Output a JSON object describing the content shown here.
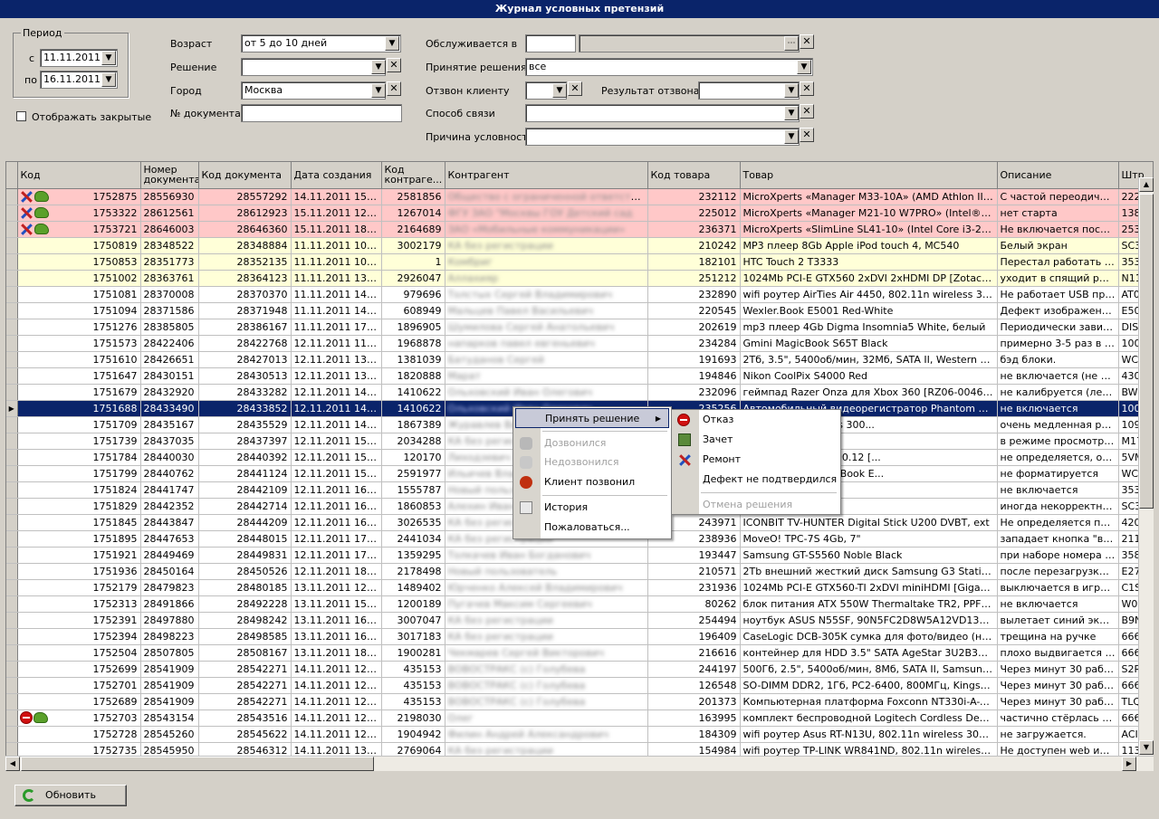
{
  "title": "Журнал условных претензий",
  "period": {
    "legend": "Период",
    "from_label": "с",
    "from": "11.11.2011",
    "to_label": "по",
    "to": "16.11.2011"
  },
  "show_closed": "Отображать закрытые",
  "filters": {
    "age_label": "Возраст",
    "age": "от 5 до 10 дней",
    "decision_label": "Решение",
    "decision": "",
    "city_label": "Город",
    "city": "Москва",
    "doc_label": "№ документа",
    "doc": "",
    "served_label": "Обслуживается в",
    "served": "",
    "accept_label": "Принятие решения",
    "accept": "все",
    "callback_label": "Отзвон клиенту",
    "callback": "",
    "callres_label": "Результат отзвона",
    "callres": "",
    "contact_label": "Способ связи",
    "contact": "",
    "reason_label": "Причина условности",
    "reason": ""
  },
  "columns": [
    "Код",
    "Номер документа",
    "Код документа",
    "Дата создания",
    "Код контраге...",
    "Контрагент",
    "Код товара",
    "Товар",
    "Описание",
    "Штр"
  ],
  "rows": [
    {
      "s": "pink",
      "i": "tc",
      "code": "1752875",
      "num": "28556930",
      "doc": "28557292",
      "date": "14.11.2011 15:14",
      "cc": "2581856",
      "cp": "Общество с ограниченной ответственностью",
      "gc": "232112",
      "goods": "MicroXperts «Manager M33-10A» (AMD Athlon II X4 64...",
      "desc": "С частой переодичнос...",
      "bc": "2225"
    },
    {
      "s": "pink",
      "i": "tc",
      "code": "1753322",
      "num": "28612561",
      "doc": "28612923",
      "date": "15.11.2011 12:01",
      "cc": "1267014",
      "cp": "ФГУ ЗАО \"Москвы ГОУ Детский сад",
      "gc": "225012",
      "goods": "MicroXperts «Manager M21-10 W7PRO» (Intel® Core...",
      "desc": "нет старта",
      "bc": "1383"
    },
    {
      "s": "pink",
      "i": "tc",
      "code": "1753721",
      "num": "28646003",
      "doc": "28646360",
      "date": "15.11.2011 18:27",
      "cc": "2164689",
      "cp": "ЗАО «Мобильные коммуникации»",
      "gc": "236371",
      "goods": "MicroXperts «SlimLine SL41-10» (Intel Core i3-2100, RA...",
      "desc": "Не включается после ...",
      "bc": "2539"
    },
    {
      "s": "yellow",
      "i": "",
      "code": "1750819",
      "num": "28348522",
      "doc": "28348884",
      "date": "11.11.2011 10:05",
      "cc": "3002179",
      "cp": "КА без регистрации",
      "gc": "210242",
      "goods": "MP3 плеер 8Gb Apple iPod touch 4, MC540",
      "desc": "Белый экран",
      "bc": "SC3\\"
    },
    {
      "s": "yellow",
      "i": "",
      "code": "1750853",
      "num": "28351773",
      "doc": "28352135",
      "date": "11.11.2011 10:52",
      "cc": "1",
      "cp": "Комбриг",
      "gc": "182101",
      "goods": "HTC Touch 2  T3333",
      "desc": "Перестал работать та...",
      "bc": "3539"
    },
    {
      "s": "yellow",
      "i": "",
      "code": "1751002",
      "num": "28363761",
      "doc": "28364123",
      "date": "11.11.2011 13:15",
      "cc": "2926047",
      "cp": "Аллахияр",
      "gc": "251212",
      "goods": "1024Mb PCI-E GTX560 2xDVI 2xHDMI DP [Zotac ZT-50...",
      "desc": " уходит в спящий реж...",
      "bc": "N113"
    },
    {
      "s": "",
      "i": "",
      "code": "1751081",
      "num": "28370008",
      "doc": "28370370",
      "date": "11.11.2011 14:29",
      "cc": "979696",
      "cp": "Толстых Сергей Владимирович",
      "gc": "232890",
      "goods": "wifi роутер AirTies Air 4450, 802.11n wireless 300Mbp...",
      "desc": "Не работает USB прин...",
      "bc": "AT06"
    },
    {
      "s": "",
      "i": "",
      "code": "1751094",
      "num": "28371586",
      "doc": "28371948",
      "date": "11.11.2011 14:48",
      "cc": "608949",
      "cp": "Мальцев Павел Васильевич",
      "gc": "220545",
      "goods": "Wexler.Book E5001 Red-White",
      "desc": "Дефект изображение,...",
      "bc": "E500"
    },
    {
      "s": "",
      "i": "",
      "code": "1751276",
      "num": "28385805",
      "doc": "28386167",
      "date": "11.11.2011 17:26",
      "cc": "1896905",
      "cp": "Шумилова Сергей Анатольевич",
      "gc": "202619",
      "goods": "mp3 плеер 4Gb Digma Insomnia5 White, белый",
      "desc": "Периодически зависае...",
      "bc": "DIS5"
    },
    {
      "s": "",
      "i": "",
      "code": "1751573",
      "num": "28422406",
      "doc": "28422768",
      "date": "12.11.2011 11:55",
      "cc": "1968878",
      "cp": "напарков павел евгеньевич",
      "gc": "234284",
      "goods": "Gmini MagicBook S65T Black",
      "desc": "примерно 3-5 раз в де...",
      "bc": "1000"
    },
    {
      "s": "",
      "i": "",
      "code": "1751610",
      "num": "28426651",
      "doc": "28427013",
      "date": "12.11.2011 13:01",
      "cc": "1381039",
      "cp": "Батуданов Сергей",
      "gc": "191693",
      "goods": "2Тб, 3.5\", 5400об/мин, 32Мб, SATA II, Western Digita...",
      "desc": "бэд блоки.",
      "bc": "WCA"
    },
    {
      "s": "",
      "i": "",
      "code": "1751647",
      "num": "28430151",
      "doc": "28430513",
      "date": "12.11.2011 13:47",
      "cc": "1820888",
      "cp": "Марат",
      "gc": "194846",
      "goods": "Nikon CoolPix S4000 Red",
      "desc": "не включается (не зар...",
      "bc": "4304"
    },
    {
      "s": "",
      "i": "",
      "code": "1751679",
      "num": "28432920",
      "doc": "28433282",
      "date": "12.11.2011 14:21",
      "cc": "1410622",
      "cp": "Ольховский Иван Олегович",
      "gc": "232096",
      "goods": "геймпад Razer Onza для Xbox 360 [RZ06-00460100-R...",
      "desc": "не калибруется (левы...",
      "bc": "BW1"
    },
    {
      "s": "sel",
      "i": "",
      "code": "1751688",
      "num": "28433490",
      "doc": "28433852",
      "date": "12.11.2011 14:29",
      "cc": "1410622",
      "cp": "Ольховский Иван Олегович",
      "gc": "235256",
      "goods": "Автомобильный видеорегистратор Phantom VR-107",
      "desc": "не включается",
      "bc": "1000"
    },
    {
      "s": "",
      "i": "",
      "code": "1751709",
      "num": "28435167",
      "doc": "28435529",
      "date": "12.11.2011 14:49",
      "cc": "1867389",
      "cp": "Журавлев Вадим",
      "gc": "",
      "goods": "D, 802.11n Wireless 300...",
      "desc": "очень медленная разд...",
      "bc": "1096"
    },
    {
      "s": "",
      "i": "",
      "code": "1751739",
      "num": "28437035",
      "doc": "28437397",
      "date": "12.11.2011 15:12",
      "cc": "2034288",
      "cp": "КА без регистрации",
      "gc": "",
      "goods": "300/W, 4.3\" TFT",
      "desc": "в режиме просмотра в...",
      "bc": "M17"
    },
    {
      "s": "",
      "i": "",
      "code": "1751784",
      "num": "28440030",
      "doc": "28440392",
      "date": "12.11.2011 15:49",
      "cc": "120170",
      "cp": "Лиходзевич Виталий",
      "gc": "",
      "goods": "gate Barracuda 7200.12 [...",
      "desc": "не определяется, оши...",
      "bc": "5VM"
    },
    {
      "s": "",
      "i": "",
      "code": "1751799",
      "num": "28440762",
      "doc": "28441124",
      "date": "12.11.2011 15:58",
      "cc": "2591977",
      "cp": "Ильичев Владимир",
      "gc": "",
      "goods": "Western Digital My Book E...",
      "desc": "не форматируется",
      "bc": "WCA"
    },
    {
      "s": "",
      "i": "",
      "code": "1751824",
      "num": "28441747",
      "doc": "28442109",
      "date": "12.11.2011 16:10",
      "cc": "1555787",
      "cp": "Новый пользователь",
      "gc": "",
      "goods": "104",
      "desc": "не включается",
      "bc": "3537"
    },
    {
      "s": "",
      "i": "",
      "code": "1751829",
      "num": "28442352",
      "doc": "28442714",
      "date": "12.11.2011 16:19",
      "cc": "1860853",
      "cp": "Алехин Иван",
      "gc": "",
      "goods": "ouch 4, MC544",
      "desc": "иногда некорректная ...",
      "bc": "SC3L"
    },
    {
      "s": "",
      "i": "",
      "code": "1751845",
      "num": "28443847",
      "doc": "28444209",
      "date": "12.11.2011 16:39",
      "cc": "3026535",
      "cp": "КА без регистрации",
      "gc": "243971",
      "goods": "ICONBIT TV-HUNTER Digital Stick U200 DVBT, ext",
      "desc": "Не определяется прог...",
      "bc": "4201"
    },
    {
      "s": "",
      "i": "",
      "code": "1751895",
      "num": "28447653",
      "doc": "28448015",
      "date": "12.11.2011 17:30",
      "cc": "2441034",
      "cp": "КА без регистрации",
      "gc": "238936",
      "goods": "MoveO! TPC-7S 4Gb, 7\"",
      "desc": "западает кнопка \"возв...",
      "bc": "2111"
    },
    {
      "s": "",
      "i": "",
      "code": "1751921",
      "num": "28449469",
      "doc": "28449831",
      "date": "12.11.2011 17:53",
      "cc": "1359295",
      "cp": "Толкачев Иван Богданович",
      "gc": "193447",
      "goods": "Samsung GT-S5560 Noble Black",
      "desc": "при наборе номера не ...",
      "bc": "3586"
    },
    {
      "s": "",
      "i": "",
      "code": "1751936",
      "num": "28450164",
      "doc": "28450526",
      "date": "12.11.2011 18:03",
      "cc": "2178498",
      "cp": "Новый пользователь",
      "gc": "210571",
      "goods": "2Tb внешний жесткий диск Samsung G3 Station 3.5\",...",
      "desc": "после перезагрузки оп...",
      "bc": "E272"
    },
    {
      "s": "",
      "i": "",
      "code": "1752179",
      "num": "28479823",
      "doc": "28480185",
      "date": "13.11.2011 12:10",
      "cc": "1489402",
      "cp": "Юрченко Алексей Владимирович",
      "gc": "231936",
      "goods": "1024Mb PCI-E GTX560-TI 2xDVI miniHDMI [Gigabyte G...",
      "desc": "выключается в играх(...",
      "bc": "C1SM"
    },
    {
      "s": "",
      "i": "",
      "code": "1752313",
      "num": "28491866",
      "doc": "28492228",
      "date": "13.11.2011 15:06",
      "cc": "1200189",
      "cp": "Пугачев Максим Сергеевич",
      "gc": "80262",
      "goods": "блок питания ATX 550W Thermaltake TR2, PPFC, вен...",
      "desc": "не включается",
      "bc": "W01"
    },
    {
      "s": "",
      "i": "",
      "code": "1752391",
      "num": "28497880",
      "doc": "28498242",
      "date": "13.11.2011 16:22",
      "cc": "3007047",
      "cp": "КА без регистрации",
      "gc": "254494",
      "goods": "ноутбук ASUS N55SF, 90N5FC2D8W5A12VD13AU, 15....",
      "desc": "вылетает синий экран ...",
      "bc": "B9N0"
    },
    {
      "s": "",
      "i": "",
      "code": "1752394",
      "num": "28498223",
      "doc": "28498585",
      "date": "13.11.2011 16:27",
      "cc": "3017183",
      "cp": "КА без регистрации",
      "gc": "196409",
      "goods": "CaseLogic DCB-305K сумка для фото/видео (нейлон,...",
      "desc": "трещина на ручке",
      "bc": "6660"
    },
    {
      "s": "",
      "i": "",
      "code": "1752504",
      "num": "28507805",
      "doc": "28508167",
      "date": "13.11.2011 18:54",
      "cc": "1900281",
      "cp": "Чекмарев Сергей Викторович",
      "gc": "216616",
      "goods": "контейнер для HDD 3.5\" SATA AgeStar 3U2B3A RAID...",
      "desc": "плохо выдвигается од...",
      "bc": "6660"
    },
    {
      "s": "",
      "i": "",
      "code": "1752699",
      "num": "28541909",
      "doc": "28542271",
      "date": "14.11.2011 12:20",
      "cc": "435153",
      "cp": "ВОВОСТРАКС  (с)  Голубева",
      "gc": "244197",
      "goods": "500Гб, 2.5\", 5400об/мин, 8Мб, SATA II, Samsung Spin...",
      "desc": "Через минут 30 работ...",
      "bc": "S2R7"
    },
    {
      "s": "",
      "i": "",
      "code": "1752701",
      "num": "28541909",
      "doc": "28542271",
      "date": "14.11.2011 12:20",
      "cc": "435153",
      "cp": "ВОВОСТРАКС  (с)  Голубева",
      "gc": "126548",
      "goods": "SO-DIMM DDR2, 1Гб, PC2-6400, 800МГц, Kingston, KV...",
      "desc": "Через минут 30 работ...",
      "bc": "6660"
    },
    {
      "s": "",
      "i": "",
      "code": "1752689",
      "num": "28541909",
      "doc": "28542271",
      "date": "14.11.2011 12:20",
      "cc": "435153",
      "cp": "ВОВОСТРАКС  (с)  Голубева",
      "gc": "201373",
      "goods": "Компьютерная платформа Foxconn NT330i-A-W-AE-...",
      "desc": "Через минут 30 работ...",
      "bc": "TLQE"
    },
    {
      "s": "",
      "i": "sc",
      "code": "1752703",
      "num": "28543154",
      "doc": "28543516",
      "date": "14.11.2011 12:33",
      "cc": "2198030",
      "cp": "Олег",
      "gc": "163995",
      "goods": "комплект беспроводной Logitech Cordless Desktop S...",
      "desc": "частично стёрлась ма...",
      "bc": "6660"
    },
    {
      "s": "",
      "i": "",
      "code": "1752728",
      "num": "28545260",
      "doc": "28545622",
      "date": "14.11.2011 12:52",
      "cc": "1904942",
      "cp": "Филин Андрей Александрович",
      "gc": "184309",
      "goods": "wifi роутер Asus RT-N13U, 802.11n wireless 300Mbps ...",
      "desc": "не загружается.",
      "bc": "ACIE"
    },
    {
      "s": "",
      "i": "",
      "code": "1752735",
      "num": "28545950",
      "doc": "28546312",
      "date": "14.11.2011 13:01",
      "cc": "2769064",
      "cp": "КА без регистрации",
      "gc": "154984",
      "goods": "wifi роутер TP-LINK WR841ND, 802.11n wireless 300M...",
      "desc": "Не доступен  web инте...",
      "bc": "1139"
    }
  ],
  "menu": {
    "accept": "Принять решение",
    "dialed": "Дозвонился",
    "not_dialed": "Недозвонился",
    "client_called": "Клиент позвонил",
    "history": "История",
    "complain": "Пожаловаться..."
  },
  "submenu": {
    "refuse": "Отказ",
    "credit": "Зачет",
    "repair": "Ремонт",
    "no_defect": "Дефект не подтвердился",
    "cancel": "Отмена решения"
  },
  "refresh": "Обновить"
}
